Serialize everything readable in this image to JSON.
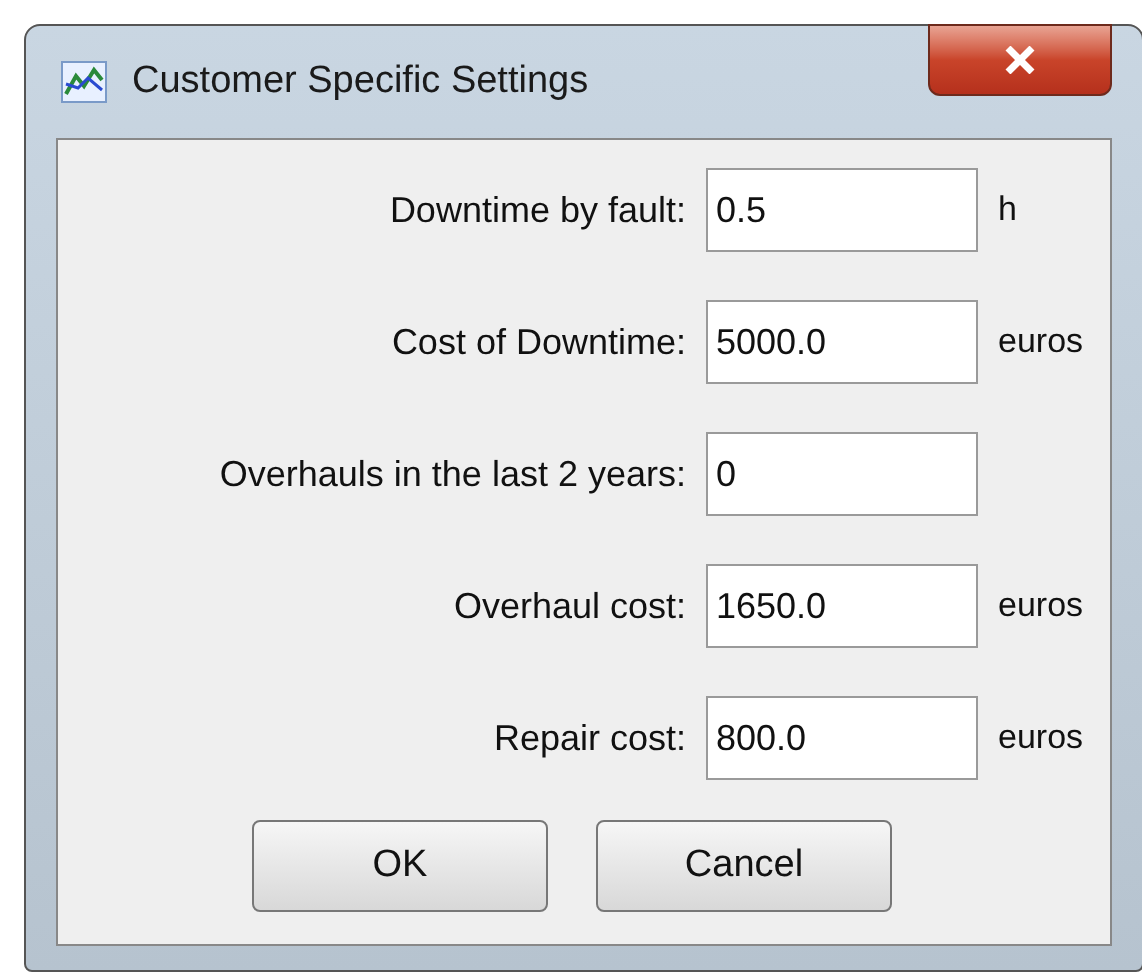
{
  "window": {
    "title": "Customer Specific Settings"
  },
  "fields": [
    {
      "label": "Downtime by fault:",
      "value": "0.5",
      "unit": "h"
    },
    {
      "label": "Cost of Downtime:",
      "value": "5000.0",
      "unit": "euros"
    },
    {
      "label": "Overhauls in the last 2 years:",
      "value": "0"
    },
    {
      "label": "Overhaul cost:",
      "value": "1650.0",
      "unit": "euros"
    },
    {
      "label": "Repair cost:",
      "value": "800.0",
      "unit": "euros"
    }
  ],
  "buttons": [
    "OK",
    "Cancel"
  ]
}
